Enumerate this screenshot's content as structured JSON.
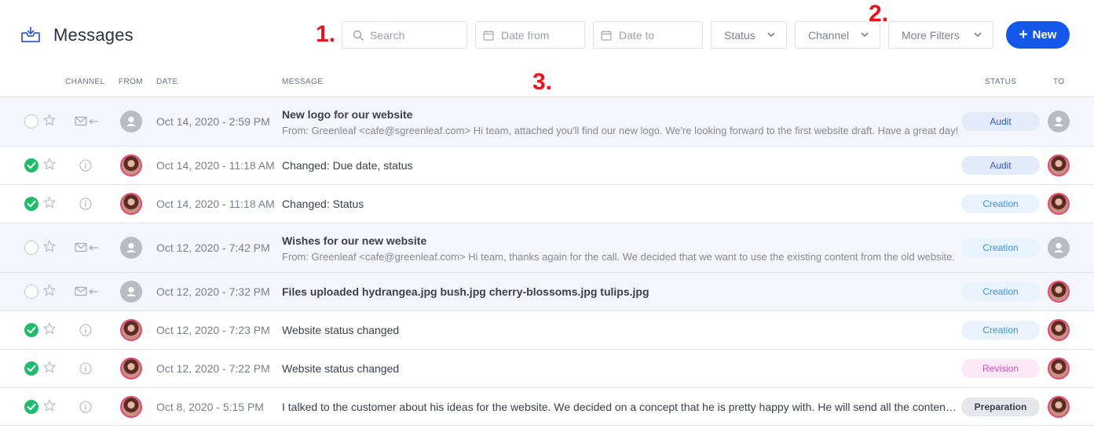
{
  "header": {
    "title": "Messages",
    "annotations": [
      "1.",
      "2.",
      "3."
    ]
  },
  "filters": {
    "search_placeholder": "Search",
    "date_from_placeholder": "Date from",
    "date_to_placeholder": "Date to",
    "status_label": "Status",
    "channel_label": "Channel",
    "more_filters_label": "More Filters",
    "new_button_label": "New"
  },
  "columns": {
    "channel": "CHANNEL",
    "from": "FROM",
    "date": "DATE",
    "message": "MESSAGE",
    "status": "STATUS",
    "to": "TO"
  },
  "colors": {
    "accent": "#1358e8",
    "done": "#1fbc6b",
    "annotation": "#e8141b"
  },
  "rows": [
    {
      "checked": false,
      "channel": "email-icon",
      "from": "gray-user",
      "date": "Oct 14, 2020 - 2:59 PM",
      "subject": "New logo for our website",
      "preview": "From: Greenleaf <cafe@sgreenleaf.com> Hi team, attached you'll find our new logo. We're looking forward to the first website draft. Have a great day!",
      "status": "Audit",
      "to": "gray-user"
    },
    {
      "checked": true,
      "channel": "info-icon",
      "from": "photo-user",
      "date": "Oct 14, 2020 - 11:18 AM",
      "subject": "Changed: Due date, status",
      "status": "Audit",
      "to": "photo-user"
    },
    {
      "checked": true,
      "channel": "info-icon",
      "from": "photo-user",
      "date": "Oct 14, 2020 - 11:18 AM",
      "subject": "Changed: Status",
      "status": "Creation",
      "to": "photo-user"
    },
    {
      "checked": false,
      "channel": "email-icon",
      "from": "gray-user",
      "date": "Oct 12, 2020 - 7:42 PM",
      "subject": "Wishes for our new website",
      "preview": "From: Greenleaf <cafe@greenleaf.com> Hi team, thanks again for the call. We decided that we want to use the existing content from the old website.",
      "status": "Creation",
      "to": "gray-user"
    },
    {
      "checked": false,
      "channel": "email-icon",
      "from": "gray-user",
      "date": "Oct 12, 2020 - 7:32 PM",
      "subject": "Files uploaded hydrangea.jpg bush.jpg cherry-blossoms.jpg tulips.jpg",
      "status": "Creation",
      "to": "photo-user"
    },
    {
      "checked": true,
      "channel": "info-icon",
      "from": "photo-user",
      "date": "Oct 12, 2020 - 7:23 PM",
      "subject": "Website status changed",
      "status": "Creation",
      "to": "photo-user"
    },
    {
      "checked": true,
      "channel": "info-icon",
      "from": "photo-user",
      "date": "Oct 12, 2020 - 7:22 PM",
      "subject": "Website status changed",
      "status": "Revision",
      "to": "photo-user"
    },
    {
      "checked": true,
      "channel": "info-icon",
      "from": "photo-user",
      "date": "Oct 8, 2020 - 5:15 PM",
      "subject": "I talked to the customer about his ideas for the website. We decided on a concept that he is pretty happy with. He will send all the content shortly.",
      "status": "Preparation",
      "to": "photo-user"
    }
  ]
}
